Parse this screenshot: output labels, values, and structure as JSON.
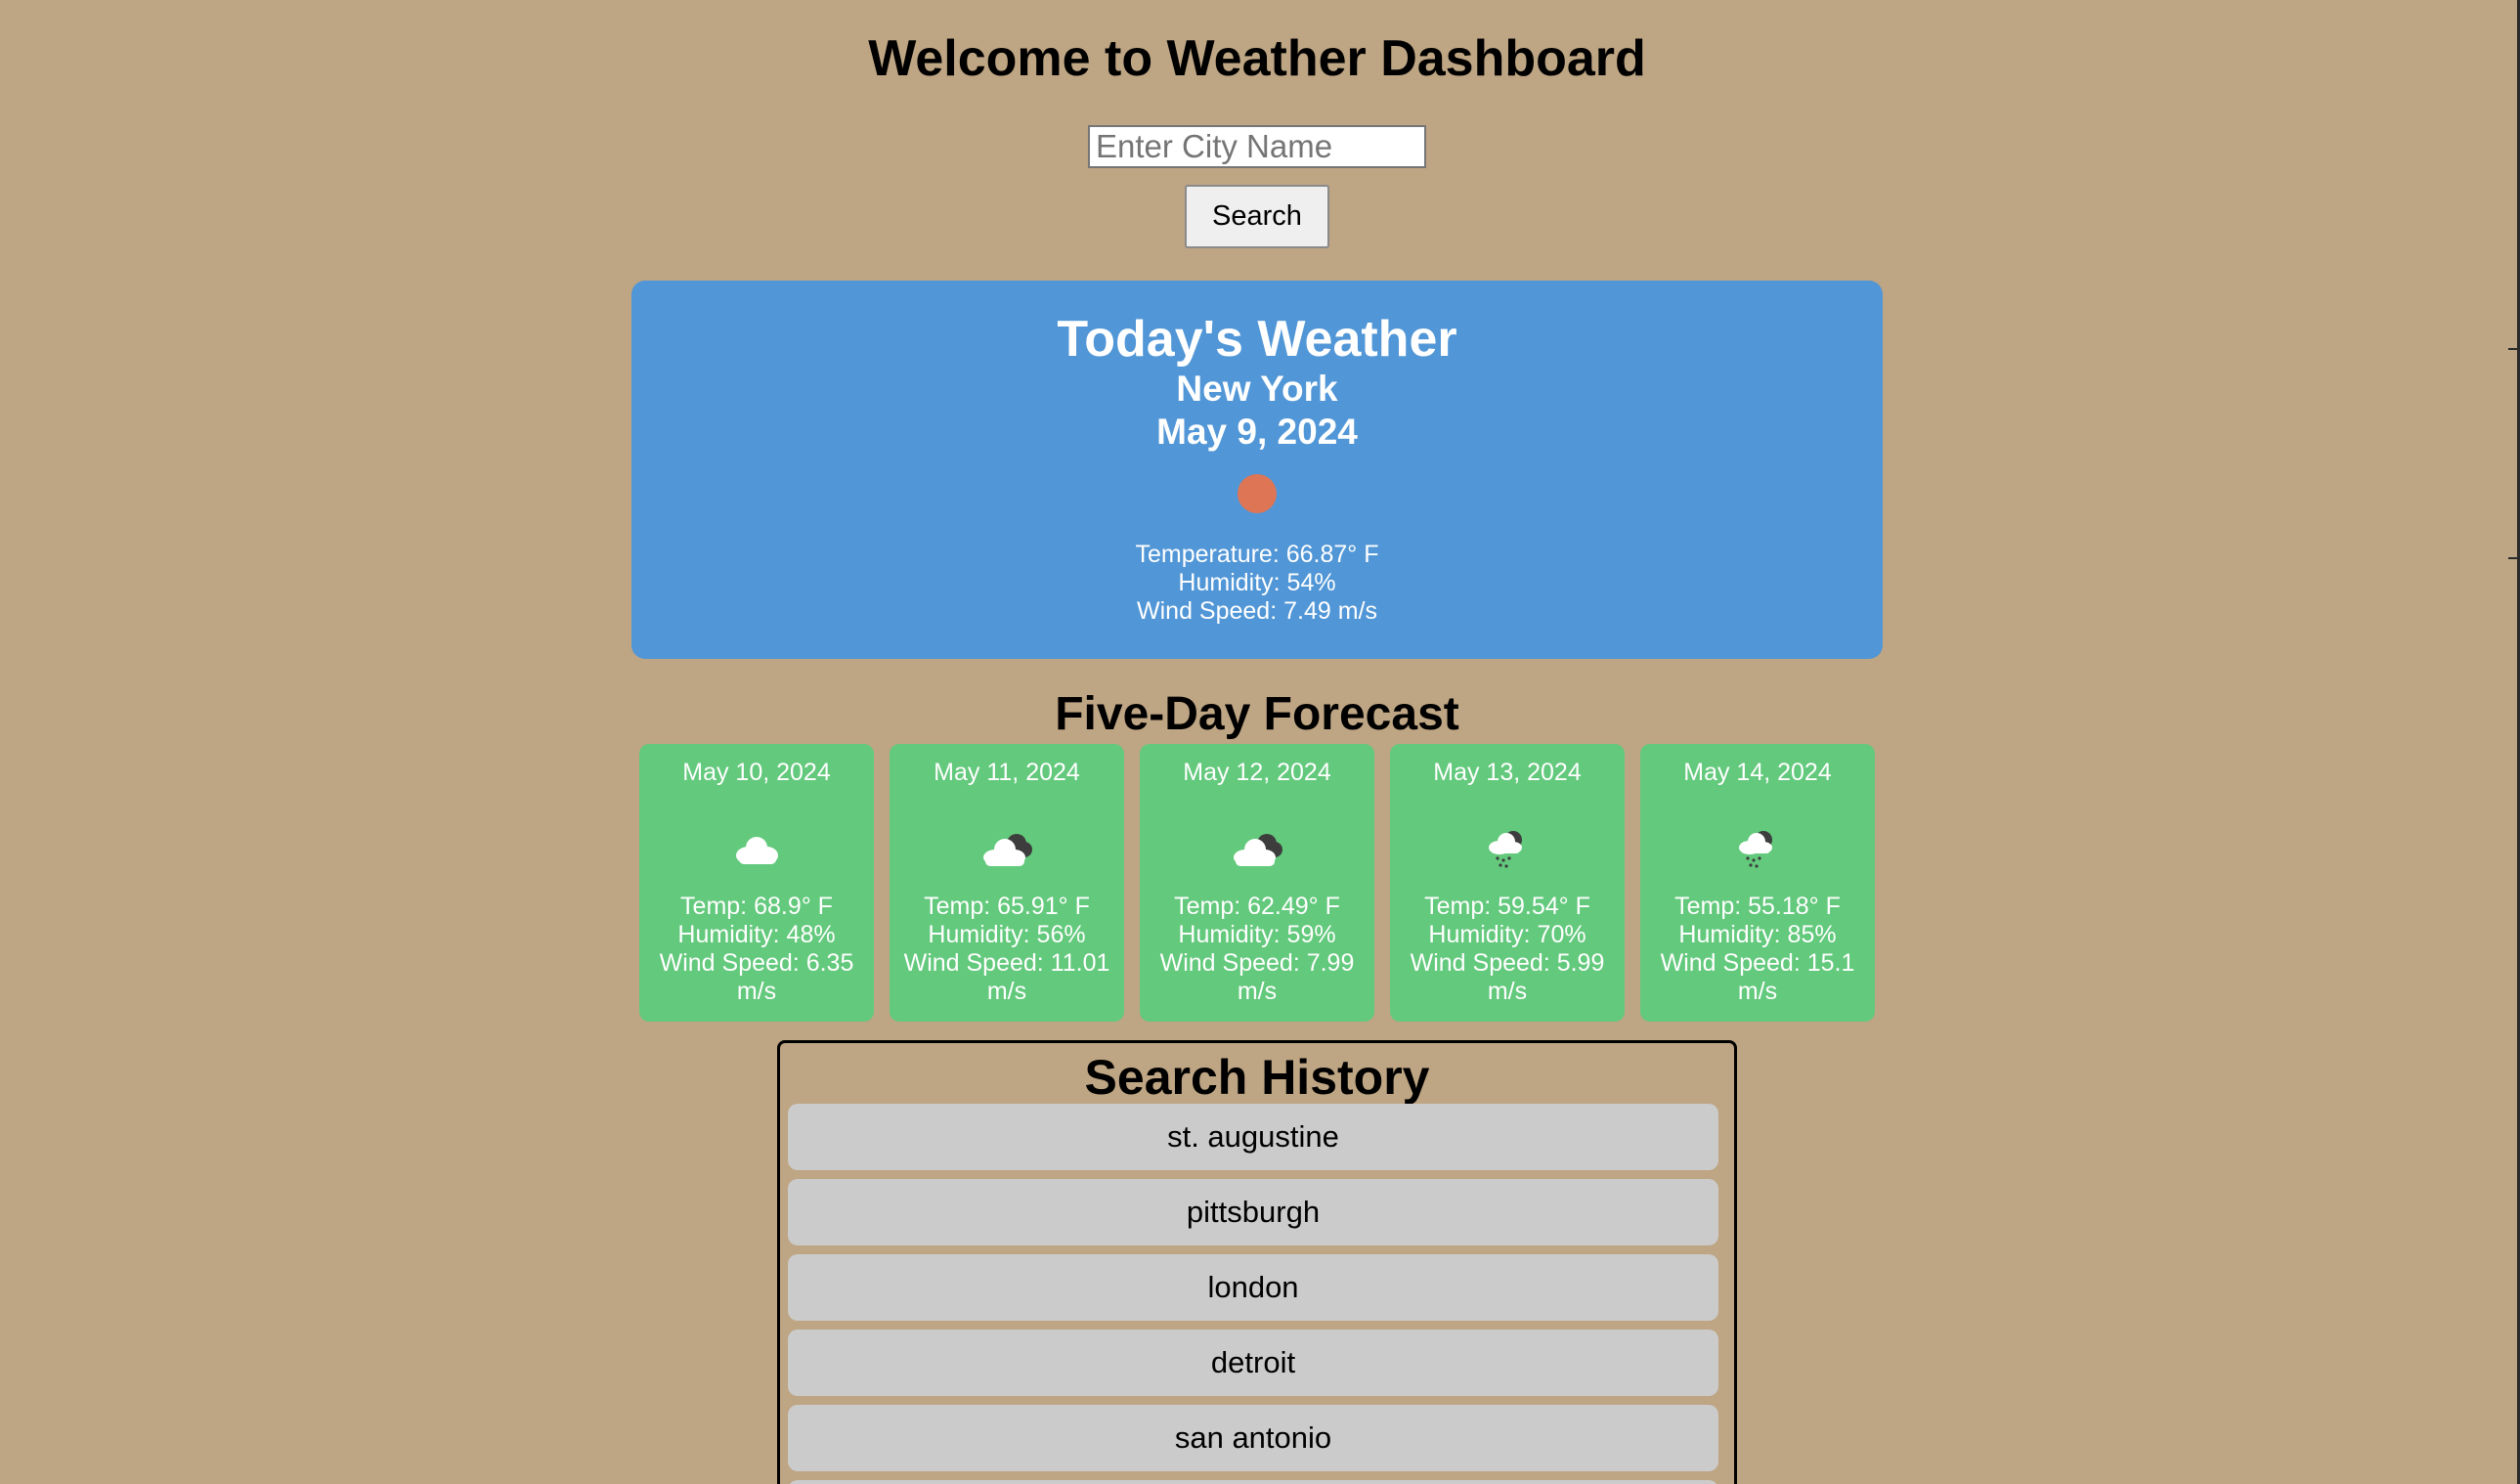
{
  "header": {
    "title": "Welcome to Weather Dashboard"
  },
  "search": {
    "placeholder": "Enter City Name",
    "value": "",
    "button_label": "Search"
  },
  "today": {
    "title": "Today's Weather",
    "city": "New York",
    "date": "May 9, 2024",
    "icon": "sun-icon",
    "temperature": "Temperature: 66.87° F",
    "humidity": "Humidity: 54%",
    "wind": "Wind Speed: 7.49 m/s"
  },
  "forecast": {
    "title": "Five-Day Forecast",
    "days": [
      {
        "date": "May 10, 2024",
        "icon": "cloud-icon",
        "temp": "Temp: 68.9° F",
        "humidity": "Humidity: 48%",
        "wind": "Wind Speed: 6.35 m/s"
      },
      {
        "date": "May 11, 2024",
        "icon": "broken-clouds-icon",
        "temp": "Temp: 65.91° F",
        "humidity": "Humidity: 56%",
        "wind": "Wind Speed: 11.01 m/s"
      },
      {
        "date": "May 12, 2024",
        "icon": "broken-clouds-icon",
        "temp": "Temp: 62.49° F",
        "humidity": "Humidity: 59%",
        "wind": "Wind Speed: 7.99 m/s"
      },
      {
        "date": "May 13, 2024",
        "icon": "rain-icon",
        "temp": "Temp: 59.54° F",
        "humidity": "Humidity: 70%",
        "wind": "Wind Speed: 5.99 m/s"
      },
      {
        "date": "May 14, 2024",
        "icon": "rain-icon",
        "temp": "Temp: 55.18° F",
        "humidity": "Humidity: 85%",
        "wind": "Wind Speed: 15.1 m/s"
      }
    ]
  },
  "history": {
    "title": "Search History",
    "items": [
      "st. augustine",
      "pittsburgh",
      "london",
      "detroit",
      "san antonio",
      ""
    ]
  },
  "colors": {
    "background": "#bea583",
    "today_card": "#5196d6",
    "forecast_card": "#63c97c",
    "history_item": "#cbcbcb",
    "sun": "#de7555"
  }
}
